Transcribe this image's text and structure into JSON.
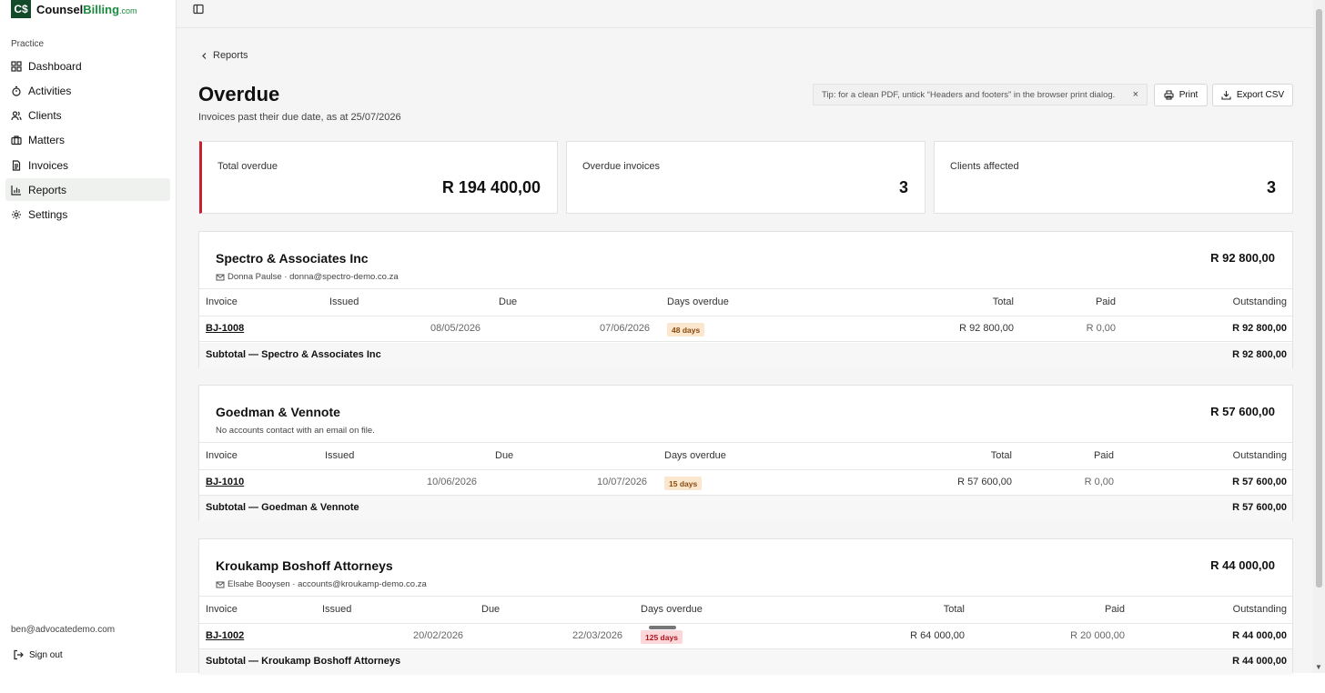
{
  "brand": {
    "logo": "C$",
    "name": "Counsel",
    "accent": "Billing",
    "tld": ".com"
  },
  "sidebar": {
    "section": "Practice",
    "items": [
      {
        "label": "Dashboard",
        "icon": "grid-icon"
      },
      {
        "label": "Activities",
        "icon": "stopwatch-icon"
      },
      {
        "label": "Clients",
        "icon": "users-icon"
      },
      {
        "label": "Matters",
        "icon": "briefcase-icon"
      },
      {
        "label": "Invoices",
        "icon": "document-icon"
      },
      {
        "label": "Reports",
        "icon": "bar-chart-icon",
        "active": true
      },
      {
        "label": "Settings",
        "icon": "gear-icon"
      }
    ],
    "user_email": "ben@advocatedemo.com",
    "sign_out": "Sign out"
  },
  "header": {
    "back": "Reports",
    "title": "Overdue",
    "subtitle": "Invoices past their due date, as at 25/07/2026",
    "tip": "Tip: for a clean PDF, untick “Headers and footers” in the browser print dialog.",
    "tip_close": "×",
    "print": "Print",
    "export": "Export CSV"
  },
  "stats": [
    {
      "label": "Total overdue",
      "value": "R 194 400,00"
    },
    {
      "label": "Overdue invoices",
      "value": "3"
    },
    {
      "label": "Clients affected",
      "value": "3"
    }
  ],
  "columns": {
    "invoice": "Invoice",
    "issued": "Issued",
    "due": "Due",
    "days": "Days overdue",
    "total": "Total",
    "paid": "Paid",
    "outstanding": "Outstanding"
  },
  "clients": [
    {
      "name": "Spectro & Associates Inc",
      "total": "R 92 800,00",
      "contact": "Donna Paulse · donna@spectro-demo.co.za",
      "row": {
        "invoice": "BJ-1008",
        "issued": "08/05/2026",
        "due": "07/06/2026",
        "days": "48 days",
        "total": "R 92 800,00",
        "paid": "R 0,00",
        "outstanding": "R 92 800,00"
      },
      "subtotal_label": "Subtotal — Spectro & Associates Inc",
      "subtotal": "R 92 800,00"
    },
    {
      "name": "Goedman & Vennote",
      "total": "R 57 600,00",
      "contact": "No accounts contact with an email on file.",
      "row": {
        "invoice": "BJ-1010",
        "issued": "10/06/2026",
        "due": "10/07/2026",
        "days": "15 days",
        "total": "R 57 600,00",
        "paid": "R 0,00",
        "outstanding": "R 57 600,00"
      },
      "subtotal_label": "Subtotal — Goedman & Vennote",
      "subtotal": "R 57 600,00"
    },
    {
      "name": "Kroukamp Boshoff Attorneys",
      "total": "R 44 000,00",
      "contact": "Elsabe Booysen · accounts@kroukamp-demo.co.za",
      "row": {
        "invoice": "BJ-1002",
        "issued": "20/02/2026",
        "due": "22/03/2026",
        "days": "125 days",
        "total": "R 64 000,00",
        "paid": "R 20 000,00",
        "outstanding": "R 44 000,00"
      },
      "subtotal_label": "Subtotal — Kroukamp Boshoff Attorneys",
      "subtotal": "R 44 000,00"
    }
  ],
  "colors": {
    "brand": "#134a2a",
    "accent": "#1e8a3f",
    "danger": "#c8202f",
    "amber_badge": "#fbe7cd",
    "red_badge": "#fbd7da"
  }
}
